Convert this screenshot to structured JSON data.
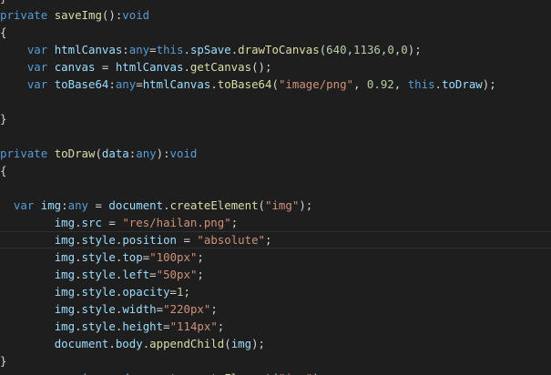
{
  "editor": {
    "colors": {
      "background": "#1e1e1e",
      "keyword": "#569cd6",
      "function": "#dcdcaa",
      "variable": "#9cdcfe",
      "string": "#ce9178",
      "number": "#b5cea8",
      "plain": "#d4d4d4",
      "current_line_border": "#2f2f2f"
    },
    "lines": [
      [
        {
          "c": "pl",
          "t": "}"
        }
      ],
      [
        {
          "c": "kw",
          "t": "private "
        },
        {
          "c": "fn",
          "t": "saveImg"
        },
        {
          "c": "pl",
          "t": "():"
        },
        {
          "c": "kw",
          "t": "void"
        }
      ],
      [
        {
          "c": "pl",
          "t": "{"
        }
      ],
      [
        {
          "c": "pl",
          "t": "    "
        },
        {
          "c": "kw",
          "t": "var "
        },
        {
          "c": "var",
          "t": "htmlCanvas"
        },
        {
          "c": "pl",
          "t": ":"
        },
        {
          "c": "kw",
          "t": "any"
        },
        {
          "c": "pl",
          "t": "="
        },
        {
          "c": "this",
          "t": "this"
        },
        {
          "c": "pl",
          "t": "."
        },
        {
          "c": "prop",
          "t": "spSave"
        },
        {
          "c": "pl",
          "t": "."
        },
        {
          "c": "fn",
          "t": "drawToCanvas"
        },
        {
          "c": "pl",
          "t": "("
        },
        {
          "c": "num",
          "t": "640"
        },
        {
          "c": "pl",
          "t": ","
        },
        {
          "c": "num",
          "t": "1136"
        },
        {
          "c": "pl",
          "t": ","
        },
        {
          "c": "num",
          "t": "0"
        },
        {
          "c": "pl",
          "t": ","
        },
        {
          "c": "num",
          "t": "0"
        },
        {
          "c": "pl",
          "t": ");"
        }
      ],
      [
        {
          "c": "pl",
          "t": "    "
        },
        {
          "c": "kw",
          "t": "var "
        },
        {
          "c": "var",
          "t": "canvas"
        },
        {
          "c": "pl",
          "t": " = "
        },
        {
          "c": "var",
          "t": "htmlCanvas"
        },
        {
          "c": "pl",
          "t": "."
        },
        {
          "c": "fn",
          "t": "getCanvas"
        },
        {
          "c": "pl",
          "t": "();"
        }
      ],
      [
        {
          "c": "pl",
          "t": "    "
        },
        {
          "c": "kw",
          "t": "var "
        },
        {
          "c": "var",
          "t": "toBase64"
        },
        {
          "c": "pl",
          "t": ":"
        },
        {
          "c": "kw",
          "t": "any"
        },
        {
          "c": "pl",
          "t": "="
        },
        {
          "c": "var",
          "t": "htmlCanvas"
        },
        {
          "c": "pl",
          "t": "."
        },
        {
          "c": "fn",
          "t": "toBase64"
        },
        {
          "c": "pl",
          "t": "("
        },
        {
          "c": "str",
          "t": "\"image/png\""
        },
        {
          "c": "pl",
          "t": ", "
        },
        {
          "c": "num",
          "t": "0.92"
        },
        {
          "c": "pl",
          "t": ", "
        },
        {
          "c": "this",
          "t": "this"
        },
        {
          "c": "pl",
          "t": "."
        },
        {
          "c": "prop",
          "t": "toDraw"
        },
        {
          "c": "pl",
          "t": ");"
        }
      ],
      [],
      [
        {
          "c": "pl",
          "t": "}"
        }
      ],
      [],
      [
        {
          "c": "kw",
          "t": "private "
        },
        {
          "c": "fn",
          "t": "toDraw"
        },
        {
          "c": "pl",
          "t": "("
        },
        {
          "c": "var",
          "t": "data"
        },
        {
          "c": "pl",
          "t": ":"
        },
        {
          "c": "kw",
          "t": "any"
        },
        {
          "c": "pl",
          "t": "):"
        },
        {
          "c": "kw",
          "t": "void"
        }
      ],
      [
        {
          "c": "pl",
          "t": "{"
        }
      ],
      [],
      [
        {
          "c": "pl",
          "t": "  "
        },
        {
          "c": "kw",
          "t": "var "
        },
        {
          "c": "var",
          "t": "img"
        },
        {
          "c": "pl",
          "t": ":"
        },
        {
          "c": "kw",
          "t": "any"
        },
        {
          "c": "pl",
          "t": " = "
        },
        {
          "c": "var",
          "t": "document"
        },
        {
          "c": "pl",
          "t": "."
        },
        {
          "c": "fn",
          "t": "createElement"
        },
        {
          "c": "pl",
          "t": "("
        },
        {
          "c": "str",
          "t": "\"img\""
        },
        {
          "c": "pl",
          "t": ");"
        }
      ],
      [
        {
          "c": "pl",
          "t": "        "
        },
        {
          "c": "var",
          "t": "img"
        },
        {
          "c": "pl",
          "t": "."
        },
        {
          "c": "prop",
          "t": "src"
        },
        {
          "c": "pl",
          "t": " = "
        },
        {
          "c": "str",
          "t": "\"res/hailan.png\""
        },
        {
          "c": "pl",
          "t": ";"
        }
      ],
      [
        {
          "c": "pl",
          "t": "        "
        },
        {
          "c": "var",
          "t": "img"
        },
        {
          "c": "pl",
          "t": "."
        },
        {
          "c": "prop",
          "t": "style"
        },
        {
          "c": "pl",
          "t": "."
        },
        {
          "c": "prop",
          "t": "position"
        },
        {
          "c": "pl",
          "t": " = "
        },
        {
          "c": "str",
          "t": "\"absolute\""
        },
        {
          "c": "pl",
          "t": ";"
        }
      ],
      [
        {
          "c": "pl",
          "t": "        "
        },
        {
          "c": "var",
          "t": "img"
        },
        {
          "c": "pl",
          "t": "."
        },
        {
          "c": "prop",
          "t": "style"
        },
        {
          "c": "pl",
          "t": "."
        },
        {
          "c": "prop",
          "t": "top"
        },
        {
          "c": "pl",
          "t": "="
        },
        {
          "c": "str",
          "t": "\"100px\""
        },
        {
          "c": "pl",
          "t": ";"
        }
      ],
      [
        {
          "c": "pl",
          "t": "        "
        },
        {
          "c": "var",
          "t": "img"
        },
        {
          "c": "pl",
          "t": "."
        },
        {
          "c": "prop",
          "t": "style"
        },
        {
          "c": "pl",
          "t": "."
        },
        {
          "c": "prop",
          "t": "left"
        },
        {
          "c": "pl",
          "t": "="
        },
        {
          "c": "str",
          "t": "\"50px\""
        },
        {
          "c": "pl",
          "t": ";"
        }
      ],
      [
        {
          "c": "pl",
          "t": "        "
        },
        {
          "c": "var",
          "t": "img"
        },
        {
          "c": "pl",
          "t": "."
        },
        {
          "c": "prop",
          "t": "style"
        },
        {
          "c": "pl",
          "t": "."
        },
        {
          "c": "prop",
          "t": "opacity"
        },
        {
          "c": "pl",
          "t": "="
        },
        {
          "c": "num",
          "t": "1"
        },
        {
          "c": "pl",
          "t": ";"
        }
      ],
      [
        {
          "c": "pl",
          "t": "        "
        },
        {
          "c": "var",
          "t": "img"
        },
        {
          "c": "pl",
          "t": "."
        },
        {
          "c": "prop",
          "t": "style"
        },
        {
          "c": "pl",
          "t": "."
        },
        {
          "c": "prop",
          "t": "width"
        },
        {
          "c": "pl",
          "t": "="
        },
        {
          "c": "str",
          "t": "\"220px\""
        },
        {
          "c": "pl",
          "t": ";"
        }
      ],
      [
        {
          "c": "pl",
          "t": "        "
        },
        {
          "c": "var",
          "t": "img"
        },
        {
          "c": "pl",
          "t": "."
        },
        {
          "c": "prop",
          "t": "style"
        },
        {
          "c": "pl",
          "t": "."
        },
        {
          "c": "prop",
          "t": "height"
        },
        {
          "c": "pl",
          "t": "="
        },
        {
          "c": "str",
          "t": "\"114px\""
        },
        {
          "c": "pl",
          "t": ";"
        }
      ],
      [
        {
          "c": "pl",
          "t": "        "
        },
        {
          "c": "var",
          "t": "document"
        },
        {
          "c": "pl",
          "t": "."
        },
        {
          "c": "prop",
          "t": "body"
        },
        {
          "c": "pl",
          "t": "."
        },
        {
          "c": "fn",
          "t": "appendChild"
        },
        {
          "c": "pl",
          "t": "("
        },
        {
          "c": "var",
          "t": "img"
        },
        {
          "c": "pl",
          "t": ");"
        }
      ],
      [
        {
          "c": "pl",
          "t": "}"
        }
      ],
      [
        {
          "c": "pl",
          "t": "        "
        },
        {
          "c": "kw",
          "t": "var "
        },
        {
          "c": "var",
          "t": "img"
        },
        {
          "c": "pl",
          "t": " = "
        },
        {
          "c": "var",
          "t": "document"
        },
        {
          "c": "pl",
          "t": "."
        },
        {
          "c": "fn",
          "t": "createElement"
        },
        {
          "c": "pl",
          "t": "("
        },
        {
          "c": "str",
          "t": "\"img\""
        },
        {
          "c": "pl",
          "t": ")"
        }
      ]
    ],
    "current_line": 14
  }
}
